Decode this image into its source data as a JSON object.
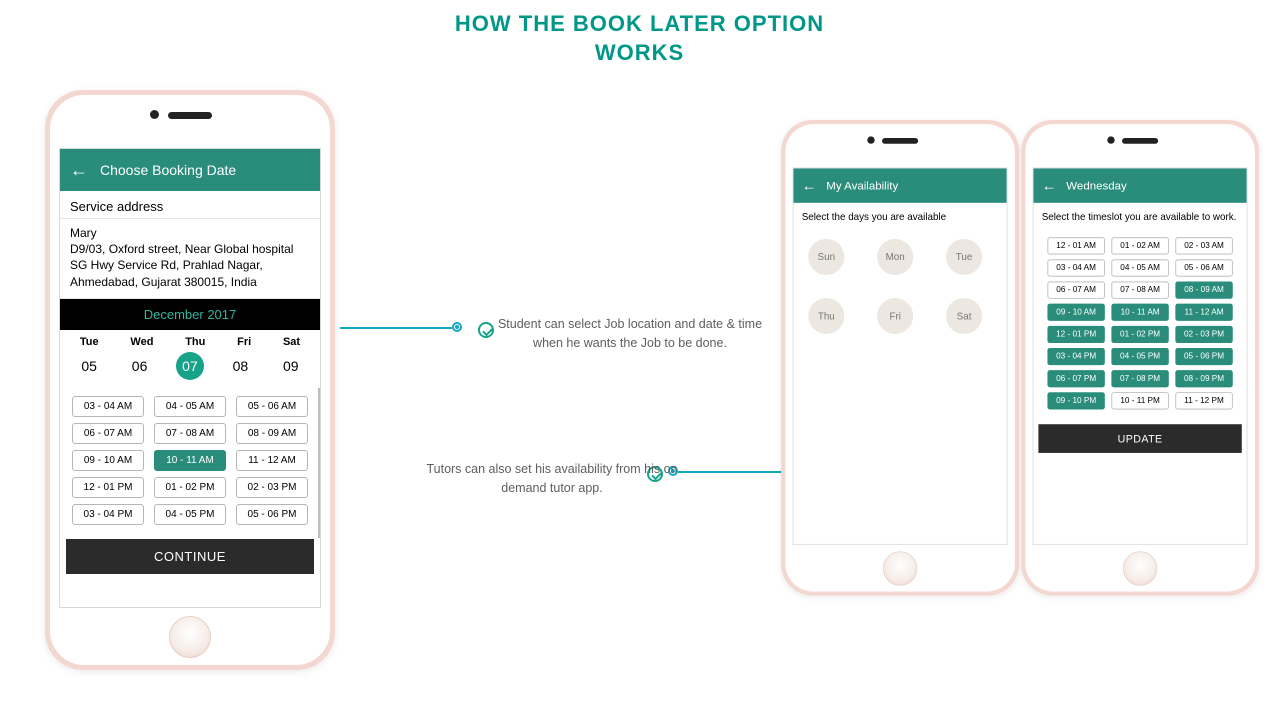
{
  "title_line1": "HOW THE BOOK LATER OPTION",
  "title_line2": "WORKS",
  "caption1": "Student can select Job location and date & time when he wants the Job to be done.",
  "caption2": "Tutors can also set his availability from his on demand tutor app.",
  "phone1": {
    "appbar": "Choose Booking Date",
    "section": "Service address",
    "addr_name": "Mary",
    "addr_l1": "D9/03, Oxford street, Near Global hospital",
    "addr_l2": "SG Hwy Service Rd, Prahlad Nagar,",
    "addr_l3": "Ahmedabad, Gujarat 380015, India",
    "month": "December 2017",
    "weekhead": [
      "Tue",
      "Wed",
      "Thu",
      "Fri",
      "Sat"
    ],
    "weekdays": [
      "05",
      "06",
      "07",
      "08",
      "09"
    ],
    "sel_day_index": 2,
    "slots": [
      [
        "03 - 04 AM",
        "04 - 05 AM",
        "05 - 06 AM"
      ],
      [
        "06 - 07 AM",
        "07 - 08 AM",
        "08 - 09 AM"
      ],
      [
        "09 - 10 AM",
        "10 - 11 AM",
        "11 - 12 AM"
      ],
      [
        "12 - 01 PM",
        "01 - 02 PM",
        "02 - 03 PM"
      ],
      [
        "03 - 04 PM",
        "04 - 05 PM",
        "05 - 06 PM"
      ]
    ],
    "sel_slot": "10 - 11 AM",
    "continue": "CONTINUE"
  },
  "phone2": {
    "appbar": "My Availability",
    "sub": "Select the days you are available",
    "days": [
      "Sun",
      "Mon",
      "Tue",
      "Thu",
      "Fri",
      "Sat"
    ]
  },
  "phone3": {
    "appbar": "Wednesday",
    "sub": "Select the timeslot you are available to work.",
    "slots": [
      [
        "12 - 01 AM",
        "01 - 02 AM",
        "02 - 03 AM"
      ],
      [
        "03 - 04 AM",
        "04 - 05 AM",
        "05 - 06 AM"
      ],
      [
        "06 - 07 AM",
        "07 - 08 AM",
        "08 - 09 AM"
      ],
      [
        "09 - 10 AM",
        "10 - 11 AM",
        "11 - 12 AM"
      ],
      [
        "12 - 01 PM",
        "01 - 02 PM",
        "02 - 03 PM"
      ],
      [
        "03 - 04 PM",
        "04 - 05 PM",
        "05 - 06 PM"
      ],
      [
        "06 - 07 PM",
        "07 - 08 PM",
        "08 - 09 PM"
      ],
      [
        "09 - 10 PM",
        "10 - 11 PM",
        "11 - 12 PM"
      ]
    ],
    "selected": [
      "08 - 09 AM",
      "09 - 10 AM",
      "10 - 11 AM",
      "11 - 12 AM",
      "12 - 01 PM",
      "01 - 02 PM",
      "02 - 03 PM",
      "03 - 04 PM",
      "04 - 05 PM",
      "05 - 06 PM",
      "06 - 07 PM",
      "07 - 08 PM",
      "08 - 09 PM",
      "09 - 10 PM"
    ],
    "update": "UPDATE"
  }
}
